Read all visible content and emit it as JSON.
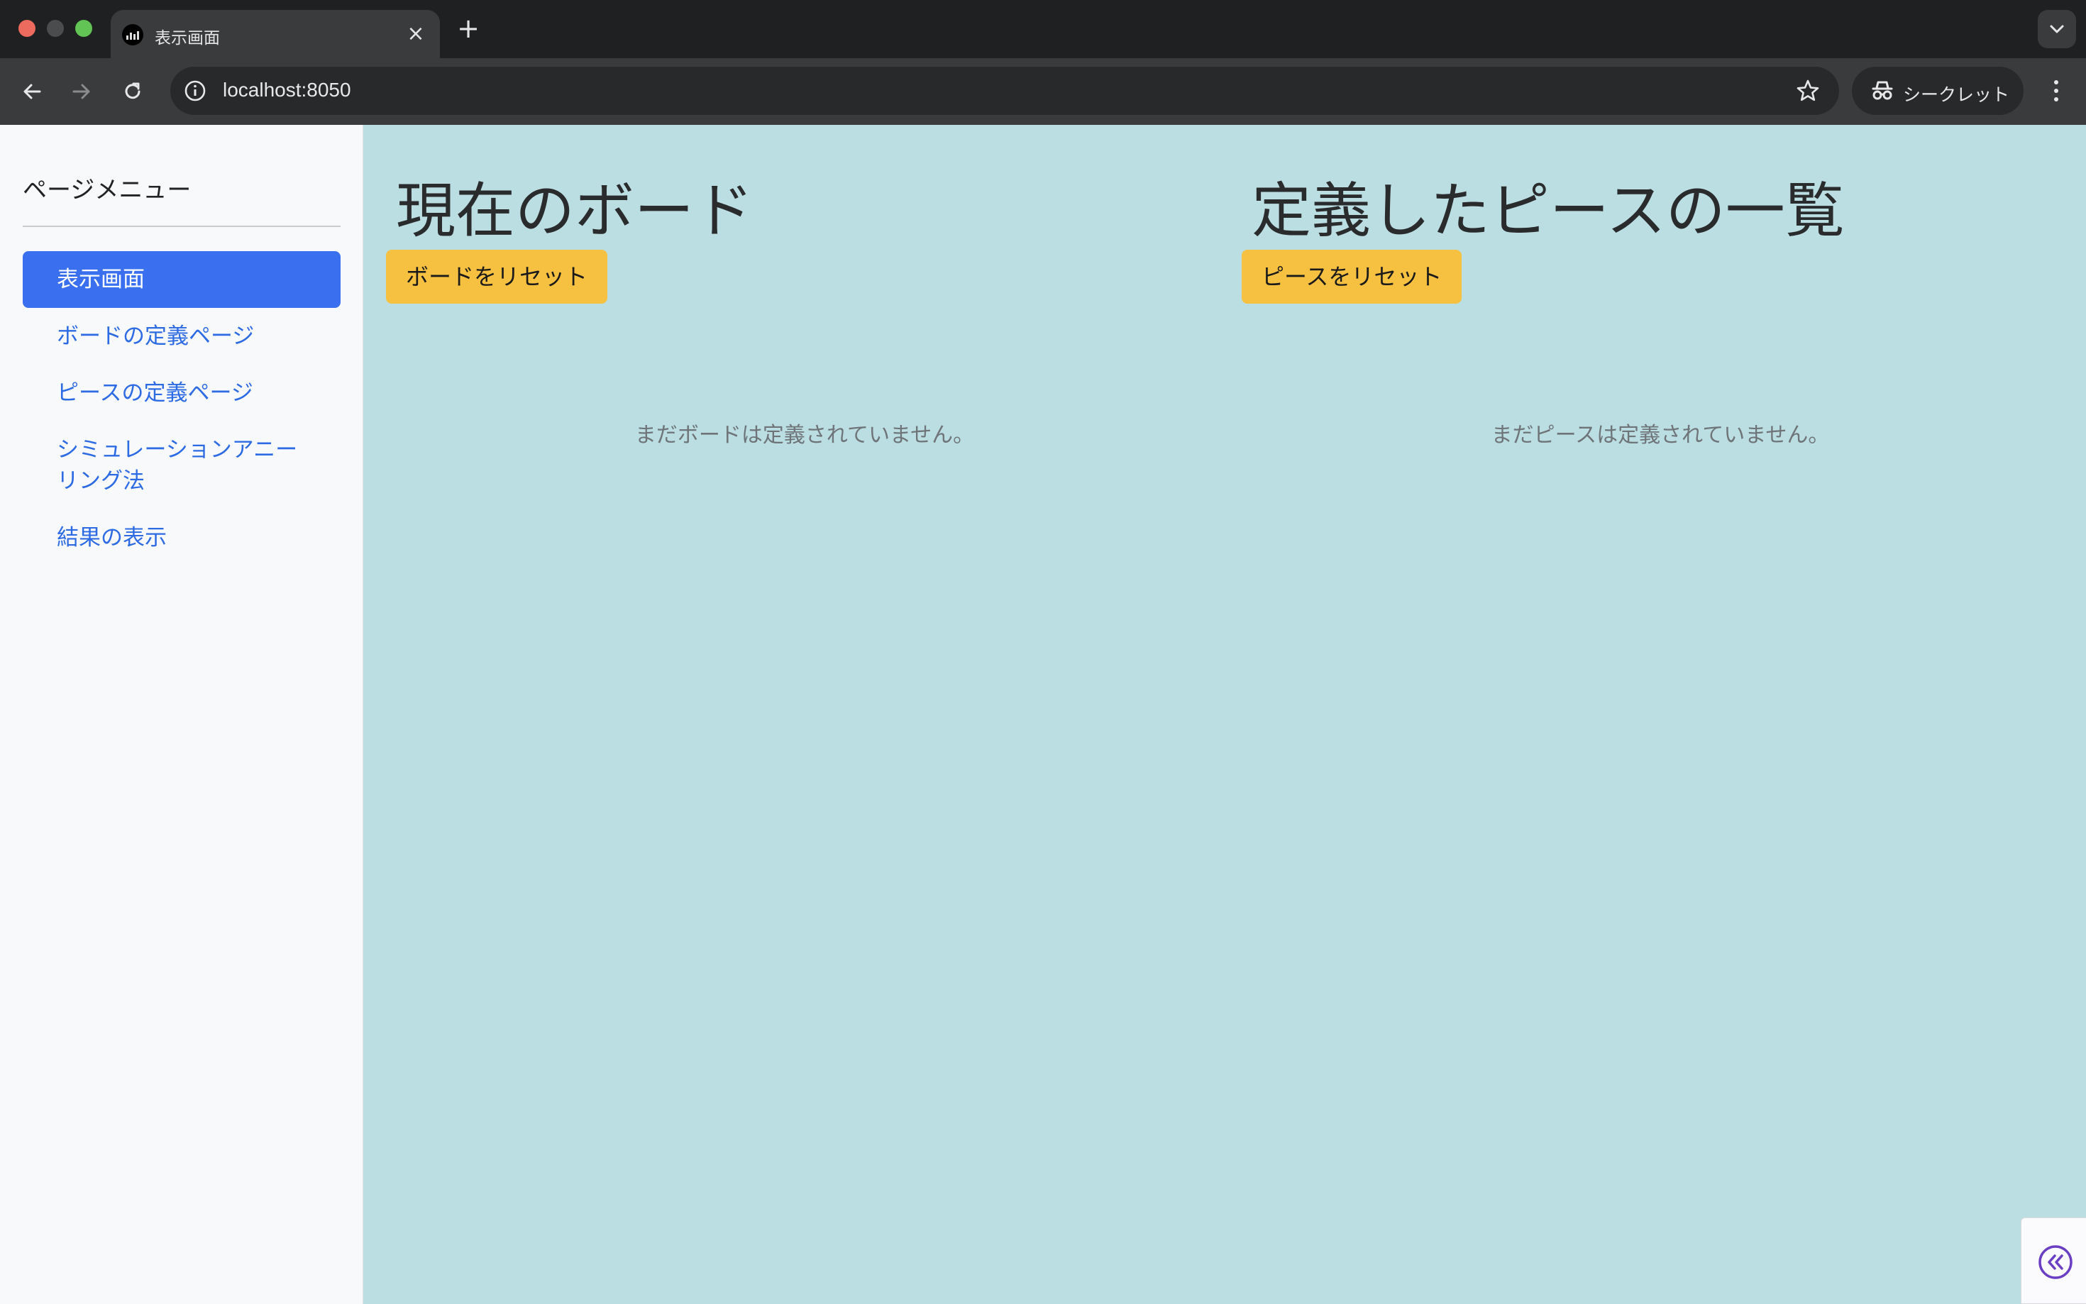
{
  "browser": {
    "tab_title": "表示画面",
    "url": "localhost:8050",
    "incognito_label": "シークレット"
  },
  "sidebar": {
    "title": "ページメニュー",
    "items": [
      {
        "label": "表示画面",
        "active": true
      },
      {
        "label": "ボードの定義ページ",
        "active": false
      },
      {
        "label": "ピースの定義ページ",
        "active": false
      },
      {
        "label": "シミュレーションアニーリング法",
        "active": false
      },
      {
        "label": "結果の表示",
        "active": false
      }
    ]
  },
  "board": {
    "heading": "現在のボード",
    "reset_label": "ボードをリセット",
    "empty_message": "まだボードは定義されていません。"
  },
  "pieces": {
    "heading": "定義したピースの一覧",
    "reset_label": "ピースをリセット",
    "empty_message": "まだピースは定義されていません。"
  },
  "colors": {
    "page_background": "#bbdee3",
    "sidebar_background": "#f8f9fb",
    "active_nav": "#3a70f0",
    "nav_link": "#2d6be4",
    "reset_button": "#f6c141",
    "collapse_icon": "#6b3fc4"
  },
  "icons": {
    "back": "arrow-left-icon",
    "forward": "arrow-right-icon",
    "reload": "reload-icon",
    "info": "info-icon",
    "bookmark": "star-icon",
    "incognito": "incognito-icon",
    "menu": "kebab-menu-icon",
    "collapse": "double-chevron-left-icon"
  }
}
